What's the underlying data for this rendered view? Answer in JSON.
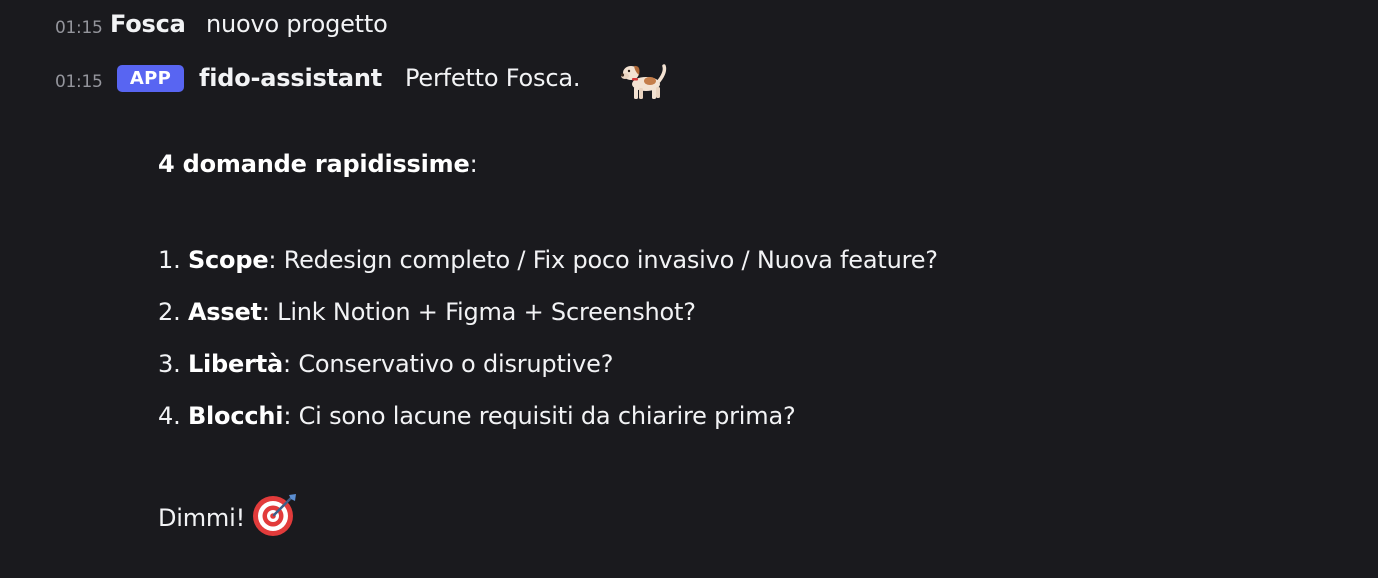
{
  "messages": [
    {
      "time": "01:15",
      "author": "Fosca",
      "text": "nuovo progetto"
    },
    {
      "time": "01:15",
      "badge": "APP",
      "author": "fido-assistant",
      "text": "Perfetto Fosca.",
      "emoji": "dog-icon"
    }
  ],
  "body": {
    "heading_bold": "4 domande rapidissime",
    "heading_suffix": ":",
    "items": [
      {
        "num": "1.",
        "label": "Scope",
        "text": ": Redesign completo / Fix poco invasivo / Nuova feature?"
      },
      {
        "num": "2.",
        "label": "Asset",
        "text": ": Link Notion + Figma + Screenshot?"
      },
      {
        "num": "3.",
        "label": "Libertà",
        "text": ": Conservativo o disruptive?"
      },
      {
        "num": "4.",
        "label": "Blocchi",
        "text": ": Ci sono lacune requisiti da chiarire prima?"
      }
    ],
    "closing": "Dimmi!",
    "closing_emoji": "target-icon"
  },
  "colors": {
    "background": "#1a1a1e",
    "badge": "#5865f2",
    "timestamp": "#94959c",
    "text": "#f2f3f5"
  }
}
